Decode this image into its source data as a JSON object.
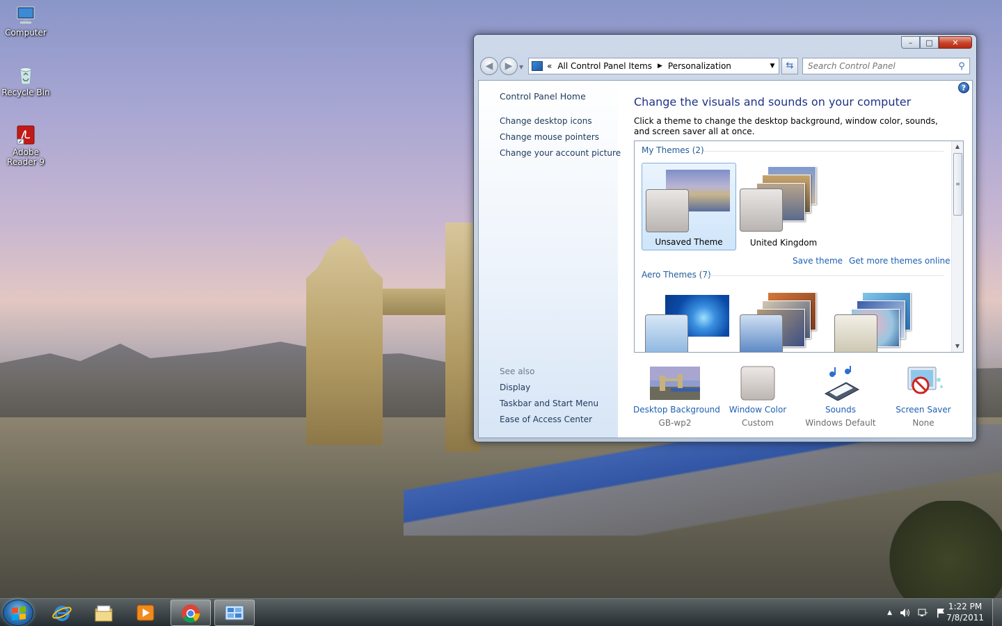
{
  "desktop": {
    "icons": [
      {
        "label": "Computer",
        "icon": "computer-icon"
      },
      {
        "label": "Recycle Bin",
        "icon": "recycle-bin-icon"
      },
      {
        "label": "Adobe Reader 9",
        "icon": "adobe-reader-icon"
      }
    ]
  },
  "window": {
    "controls": {
      "minimize": "–",
      "maximize": "□",
      "close": "✕"
    },
    "nav": {
      "back": "◀",
      "forward": "▶"
    },
    "address": {
      "prefix": "«",
      "crumbs": [
        "All Control Panel Items",
        "Personalization"
      ],
      "separator": "▶"
    },
    "search": {
      "placeholder": "Search Control Panel"
    },
    "help": "?",
    "left_pane": {
      "home": "Control Panel Home",
      "links": [
        "Change desktop icons",
        "Change mouse pointers",
        "Change your account picture"
      ],
      "see_also_label": "See also",
      "see_also": [
        "Display",
        "Taskbar and Start Menu",
        "Ease of Access Center"
      ]
    },
    "main": {
      "heading": "Change the visuals and sounds on your computer",
      "description": "Click a theme to change the desktop background, window color, sounds, and screen saver all at once.",
      "groups": [
        {
          "title": "My Themes (2)"
        },
        {
          "title": "Aero Themes (7)"
        }
      ],
      "my_themes": [
        {
          "label": "Unsaved Theme",
          "selected": true
        },
        {
          "label": "United Kingdom",
          "selected": false
        }
      ],
      "links": {
        "save": "Save theme",
        "more": "Get more themes online"
      },
      "bottom": [
        {
          "title": "Desktop Background",
          "sub": "GB-wp2",
          "icon": "wallpaper-icon"
        },
        {
          "title": "Window Color",
          "sub": "Custom",
          "icon": "window-color-icon"
        },
        {
          "title": "Sounds",
          "sub": "Windows Default",
          "icon": "sounds-icon"
        },
        {
          "title": "Screen Saver",
          "sub": "None",
          "icon": "screen-saver-icon"
        }
      ]
    }
  },
  "taskbar": {
    "apps": [
      "internet-explorer-icon",
      "windows-explorer-icon",
      "media-player-icon",
      "chrome-icon",
      "control-panel-icon"
    ],
    "active": "control-panel-icon",
    "tray": {
      "expand": "▲"
    },
    "clock": {
      "time": "1:22 PM",
      "date": "7/8/2011"
    }
  },
  "colors": {
    "link": "#1e5fb4",
    "heading": "#1e3287",
    "selected_theme": "#cfe5fa"
  }
}
